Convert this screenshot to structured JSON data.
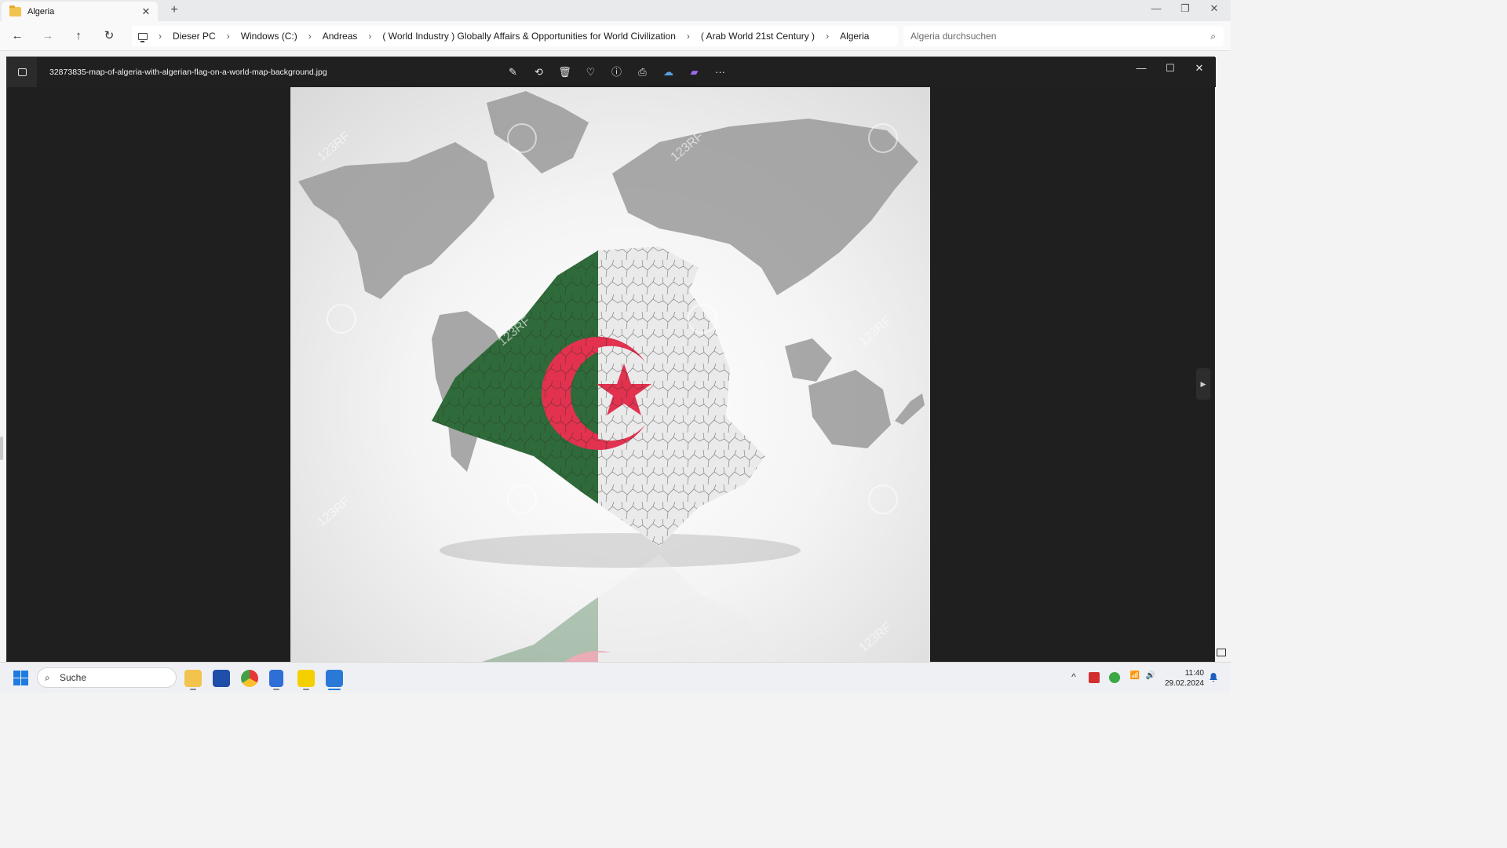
{
  "explorer": {
    "tab_title": "Algeria",
    "tab_close": "✕",
    "new_tab": "+",
    "window_minimize": "—",
    "window_restore": "❐",
    "window_close": "✕",
    "nav": {
      "back": "←",
      "forward": "→",
      "up": "↑",
      "refresh": "↻"
    },
    "breadcrumbs": [
      "Dieser PC",
      "Windows (C:)",
      "Andreas",
      "( World Industry ) Globally Affairs & Opportunities for World Civilization",
      "( Arab World 21st Century )",
      "Algeria"
    ],
    "crumb_separator": "›",
    "search_placeholder": "Algeria durchsuchen"
  },
  "viewer": {
    "filename": "32873835-map-of-algeria-with-algerian-flag-on-a-world-map-background.jpg",
    "toolbar_icons": [
      "edit-icon",
      "rotate-icon",
      "delete-icon",
      "favorite-icon",
      "info-icon",
      "print-icon",
      "onedrive-icon",
      "clipchamp-icon",
      "more-icon"
    ],
    "toolbar_glyphs": {
      "edit": "✎",
      "rotate": "⟲",
      "delete": "🗑",
      "favorite": "♡",
      "info": "ⓘ",
      "print": "⎙",
      "onedrive": "☁",
      "clipchamp": "▰",
      "more": "···"
    },
    "window_minimize": "—",
    "window_maximize": "☐",
    "window_close": "✕",
    "next_arrow": "▶",
    "watermark": "123RF"
  },
  "taskbar": {
    "search_label": "Suche",
    "time": "11:40",
    "date": "29.02.2024",
    "pinned": [
      "file-explorer",
      "microsoft-store",
      "chrome",
      "notepad",
      "player-app",
      "photos"
    ],
    "tray_overflow": "^",
    "wifi": "📶",
    "volume": "🔊"
  },
  "colors": {
    "flag_green": "#2f6b3a",
    "flag_red": "#e2324f",
    "accent": "#1e7be0",
    "viewer_bg": "#1f1f1f"
  }
}
